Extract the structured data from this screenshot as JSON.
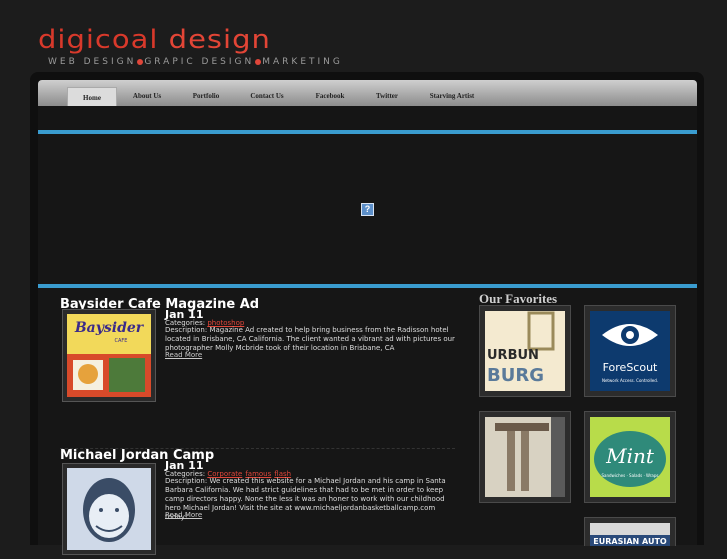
{
  "logo": {
    "part1": "digicoal",
    "part2": "design"
  },
  "tagline": {
    "seg1": "WEB DESIGN",
    "seg2": "GRAPIC DESIGN",
    "seg3": "MARKETING"
  },
  "nav": [
    "Home",
    "About Us",
    "Portfolio",
    "Contact Us",
    "Facebook",
    "Twitter",
    "Starving Artist"
  ],
  "posts": [
    {
      "title": "Baysider Cafe Magazine Ad",
      "date": "Jan 11",
      "categories_label": "Categories:",
      "categories": [
        "photoshop"
      ],
      "description": "Description: Magazine Ad created to help bring business from the Radisson hotel located in Brisbane, CA California. The client wanted a vibrant ad with pictures our photographer Molly Mcbride took of their location in Brisbane, CA",
      "read_more": "Read More",
      "thumb_text": {
        "line1": "Baysider",
        "line2": "CAFE"
      }
    },
    {
      "title": "Michael Jordan Camp",
      "date": "Jan 11",
      "categories_label": "Categories:",
      "categories": [
        "Corporate",
        "famous",
        "flash"
      ],
      "description": "Description: We created this website for a Michael Jordan and his camp in Santa Barbara California. We had strict guidelines that had to be met in order to keep camp directors happy. None the less it was an honer to work with our childhood hero Michael Jordan! Visit the site at www.michaeljordanbasketballcamp.com today!",
      "read_more": "Read More"
    }
  ],
  "favorites": {
    "title": "Our Favorites",
    "items": [
      {
        "name": "urbun-burger",
        "text": [
          "URBUN",
          "BURG"
        ]
      },
      {
        "name": "forescout",
        "text": [
          "ForeScout",
          "Network Access. Controlled."
        ]
      },
      {
        "name": "building",
        "text": []
      },
      {
        "name": "mint",
        "text": [
          "Mint",
          "Sandwiches · Salads · Wraps"
        ]
      },
      {
        "name": "eurasian-auto",
        "text": [
          "EURASIAN AUTO"
        ]
      }
    ]
  }
}
